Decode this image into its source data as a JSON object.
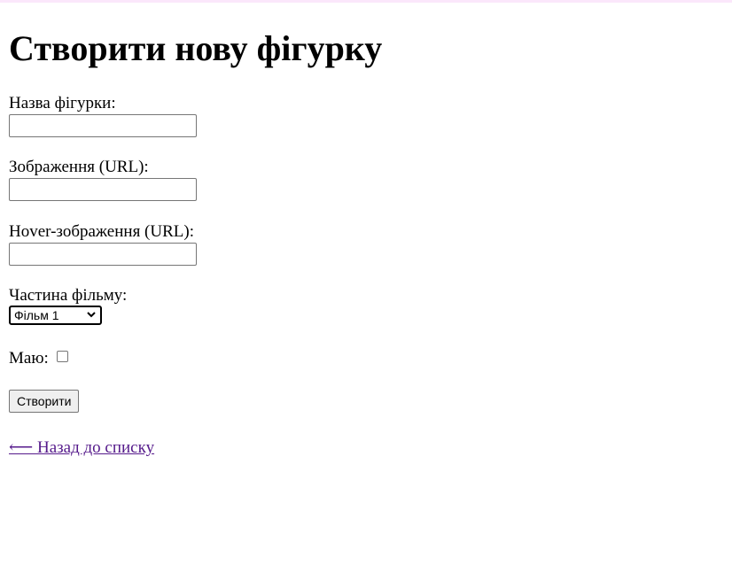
{
  "page_title": "Створити нову фігурку",
  "form": {
    "name_label": "Назва фігурки:",
    "name_value": "",
    "image_label": "Зображення (URL):",
    "image_value": "",
    "hover_label": "Hover-зображення (URL):",
    "hover_value": "",
    "film_label": "Частина фільму:",
    "film_selected": "Фільм 1",
    "owned_label": "Маю:",
    "owned_checked": false,
    "submit_label": "Створити"
  },
  "back_link": {
    "label": "⟵ Назад до списку"
  },
  "colors": {
    "link_visited": "#551a8b",
    "top_border": "#fbe7fb"
  }
}
